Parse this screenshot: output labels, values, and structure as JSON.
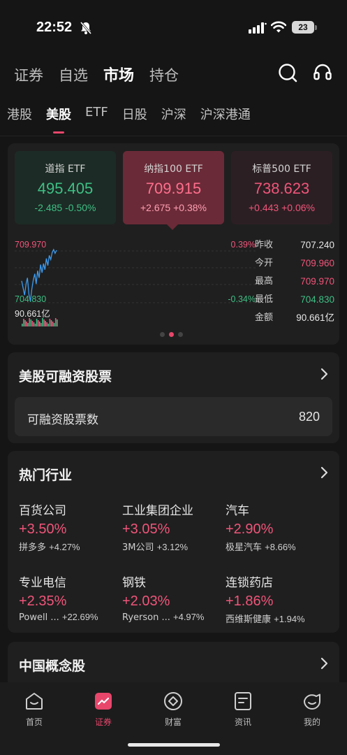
{
  "status_bar": {
    "time": "22:52",
    "battery": "23"
  },
  "top_nav": {
    "items": [
      "证券",
      "自选",
      "市场",
      "持仓"
    ],
    "active_index": 2
  },
  "sub_tabs": {
    "items": [
      "港股",
      "美股",
      "ETF",
      "日股",
      "沪深",
      "沪深港通"
    ],
    "active_index": 1
  },
  "indices": [
    {
      "name": "道指 ETF",
      "value": "495.405",
      "change": "-2.485 -0.50%",
      "direction": "down"
    },
    {
      "name": "纳指100 ETF",
      "value": "709.915",
      "change": "+2.675 +0.38%",
      "direction": "up",
      "selected": true
    },
    {
      "name": "标普500 ETF",
      "value": "738.623",
      "change": "+0.443 +0.06%",
      "direction": "up"
    }
  ],
  "mini_chart": {
    "high_label": "709.970",
    "low_label": "704.830",
    "volume_label": "90.661亿",
    "pct_high": "0.39%",
    "pct_low": "-0.34%",
    "trend": [
      706.9,
      706.2,
      705.5,
      706.6,
      707.2,
      705.6,
      704.9,
      706.1,
      707.0,
      707.6,
      706.6,
      707.9,
      707.2,
      708.5,
      707.7,
      708.6,
      708.0,
      709.1,
      708.4,
      709.4,
      709.0,
      709.7,
      709.97,
      709.6,
      709.9
    ]
  },
  "stats": [
    {
      "label": "昨收",
      "value": "707.240",
      "color": "#e6e6e6"
    },
    {
      "label": "今开",
      "value": "709.960",
      "color": "#f0557a"
    },
    {
      "label": "最高",
      "value": "709.970",
      "color": "#f0557a"
    },
    {
      "label": "最低",
      "value": "704.830",
      "color": "#3fbf85"
    },
    {
      "label": "金额",
      "value": "90.661亿",
      "color": "#e6e6e6"
    }
  ],
  "margin_section": {
    "title": "美股可融资股票",
    "row_label": "可融资股票数",
    "row_value": "820"
  },
  "hot_industry": {
    "title": "热门行业",
    "items": [
      {
        "name": "百货公司",
        "pct": "+3.50%",
        "stock": "拼多多",
        "stock_pct": "+4.27%"
      },
      {
        "name": "工业集团企业",
        "pct": "+3.05%",
        "stock": "3M公司",
        "stock_pct": "+3.12%"
      },
      {
        "name": "汽车",
        "pct": "+2.90%",
        "stock": "极星汽车",
        "stock_pct": "+8.66%"
      },
      {
        "name": "专业电信",
        "pct": "+2.35%",
        "stock": "Powell ...",
        "stock_pct": "+22.69%"
      },
      {
        "name": "钢铁",
        "pct": "+2.03%",
        "stock": "Ryerson ...",
        "stock_pct": "+4.97%"
      },
      {
        "name": "连锁药店",
        "pct": "+1.86%",
        "stock": "西维斯健康",
        "stock_pct": "+1.94%"
      }
    ]
  },
  "china_section": {
    "title": "中国概念股"
  },
  "tab_bar": {
    "items": [
      {
        "label": "首页",
        "icon": "home-icon"
      },
      {
        "label": "证券",
        "icon": "securities-icon"
      },
      {
        "label": "财富",
        "icon": "wealth-icon"
      },
      {
        "label": "资讯",
        "icon": "news-icon"
      },
      {
        "label": "我的",
        "icon": "profile-icon"
      }
    ],
    "active_index": 1
  },
  "colors": {
    "up": "#f0557a",
    "down": "#3fbf85",
    "accent": "#e8466b",
    "background": "#151515",
    "card": "#1f1f1f"
  }
}
